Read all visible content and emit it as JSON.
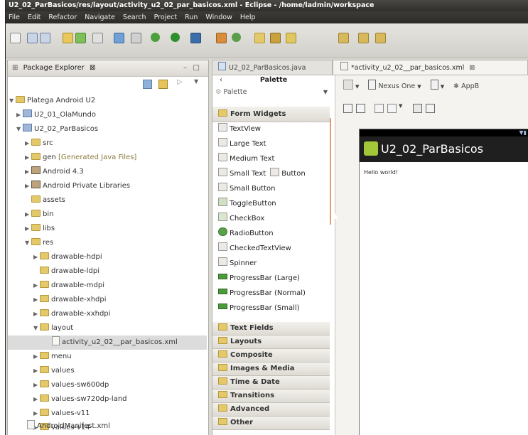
{
  "window": {
    "title": "U2_02_ParBasicos/res/layout/activity_u2_02_par_basicos.xml - Eclipse - /home/ladmin/workspace"
  },
  "menu": [
    "File",
    "Edit",
    "Refactor",
    "Navigate",
    "Search",
    "Project",
    "Run",
    "Window",
    "Help"
  ],
  "package_explorer": {
    "title": "Package Explorer",
    "tab_marker": "⊠",
    "tree": [
      {
        "label": "Platega Android U2",
        "extra": ""
      },
      {
        "label": "U2_01_OlaMundo",
        "extra": ""
      },
      {
        "label": "U2_02_ParBasicos",
        "extra": ""
      },
      {
        "label": "src",
        "extra": ""
      },
      {
        "label": "gen",
        "extra": "[Generated Java Files]"
      },
      {
        "label": "Android 4.3",
        "extra": ""
      },
      {
        "label": "Android Private Libraries",
        "extra": ""
      },
      {
        "label": "assets",
        "extra": ""
      },
      {
        "label": "bin",
        "extra": ""
      },
      {
        "label": "libs",
        "extra": ""
      },
      {
        "label": "res",
        "extra": ""
      },
      {
        "label": "drawable-hdpi",
        "extra": ""
      },
      {
        "label": "drawable-ldpi",
        "extra": ""
      },
      {
        "label": "drawable-mdpi",
        "extra": ""
      },
      {
        "label": "drawable-xhdpi",
        "extra": ""
      },
      {
        "label": "drawable-xxhdpi",
        "extra": ""
      },
      {
        "label": "layout",
        "extra": ""
      },
      {
        "label": "activity_u2_02__par_basicos.xml",
        "extra": ""
      },
      {
        "label": "menu",
        "extra": ""
      },
      {
        "label": "values",
        "extra": ""
      },
      {
        "label": "values-sw600dp",
        "extra": ""
      },
      {
        "label": "values-sw720dp-land",
        "extra": ""
      },
      {
        "label": "values-v11",
        "extra": ""
      },
      {
        "label": "values-v14",
        "extra": ""
      },
      {
        "label": "AndroidManifest.xml",
        "extra": ""
      }
    ]
  },
  "editor": {
    "tabs": [
      {
        "label": "U2_02_ParBasicos.java"
      },
      {
        "label": "*activity_u2_02__par_basicos.xml"
      }
    ],
    "palette": {
      "header": "Palette",
      "selector": "Palette",
      "category_open": "Form Widgets",
      "widgets": [
        "TextView",
        "Large Text",
        "Medium Text",
        "Small Text",
        "Button",
        "Small Button",
        "ToggleButton",
        "CheckBox",
        "RadioButton",
        "CheckedTextView",
        "Spinner",
        "ProgressBar (Large)",
        "ProgressBar (Normal)",
        "ProgressBar (Small)"
      ],
      "categories": [
        "Text Fields",
        "Layouts",
        "Composite",
        "Images & Media",
        "Time & Date",
        "Transitions",
        "Advanced",
        "Other"
      ]
    },
    "canvas": {
      "device": "Nexus One",
      "theme": "AppB",
      "app_title": "U2_02_ParBasicos",
      "hello_text": "Hello world!"
    }
  }
}
